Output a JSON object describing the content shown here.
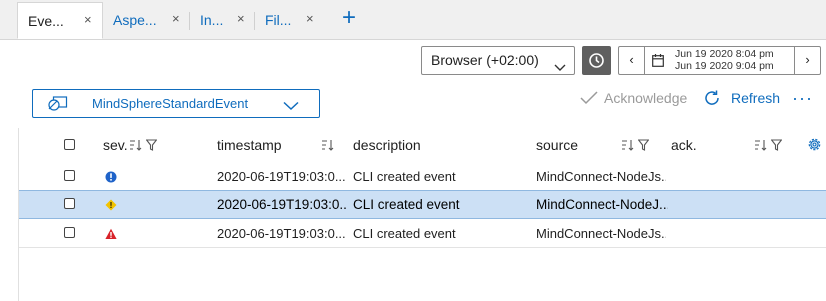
{
  "tabs": [
    {
      "label": "Eve...",
      "close": "×",
      "active": true
    },
    {
      "label": "Aspe...",
      "close": "×",
      "active": false
    },
    {
      "label": "In...",
      "close": "×",
      "active": false
    },
    {
      "label": "Fil...",
      "close": "×",
      "active": false
    }
  ],
  "add_tab": "+",
  "time": {
    "timezone": "Browser (+02:00)",
    "range_start": "Jun 19 2020 8:04 pm",
    "range_end": "Jun 19 2020 9:04 pm",
    "prev": "‹",
    "next": "›"
  },
  "toolbar": {
    "event_type": "MindSphereStandardEvent",
    "acknowledge": "Acknowledge",
    "refresh": "Refresh",
    "more": "···"
  },
  "columns": {
    "severity": "sev.",
    "timestamp": "timestamp",
    "description": "description",
    "source": "source",
    "ack": "ack."
  },
  "rows": [
    {
      "severity": "info",
      "timestamp": "2020-06-19T19:03:0...",
      "description": "CLI created event",
      "source": "MindConnect-NodeJs...",
      "ack": "",
      "selected": false
    },
    {
      "severity": "warning",
      "timestamp": "2020-06-19T19:03:0...",
      "description": "CLI created event",
      "source": "MindConnect-NodeJ...",
      "ack": "",
      "selected": true
    },
    {
      "severity": "error",
      "timestamp": "2020-06-19T19:03:0...",
      "description": "CLI created event",
      "source": "MindConnect-NodeJs...",
      "ack": "",
      "selected": false
    }
  ],
  "colors": {
    "accent": "#0f6cbd",
    "info": "#1f63c9",
    "warning": "#f2c300",
    "error": "#d8232a",
    "selected_row": "#cce0f5"
  }
}
